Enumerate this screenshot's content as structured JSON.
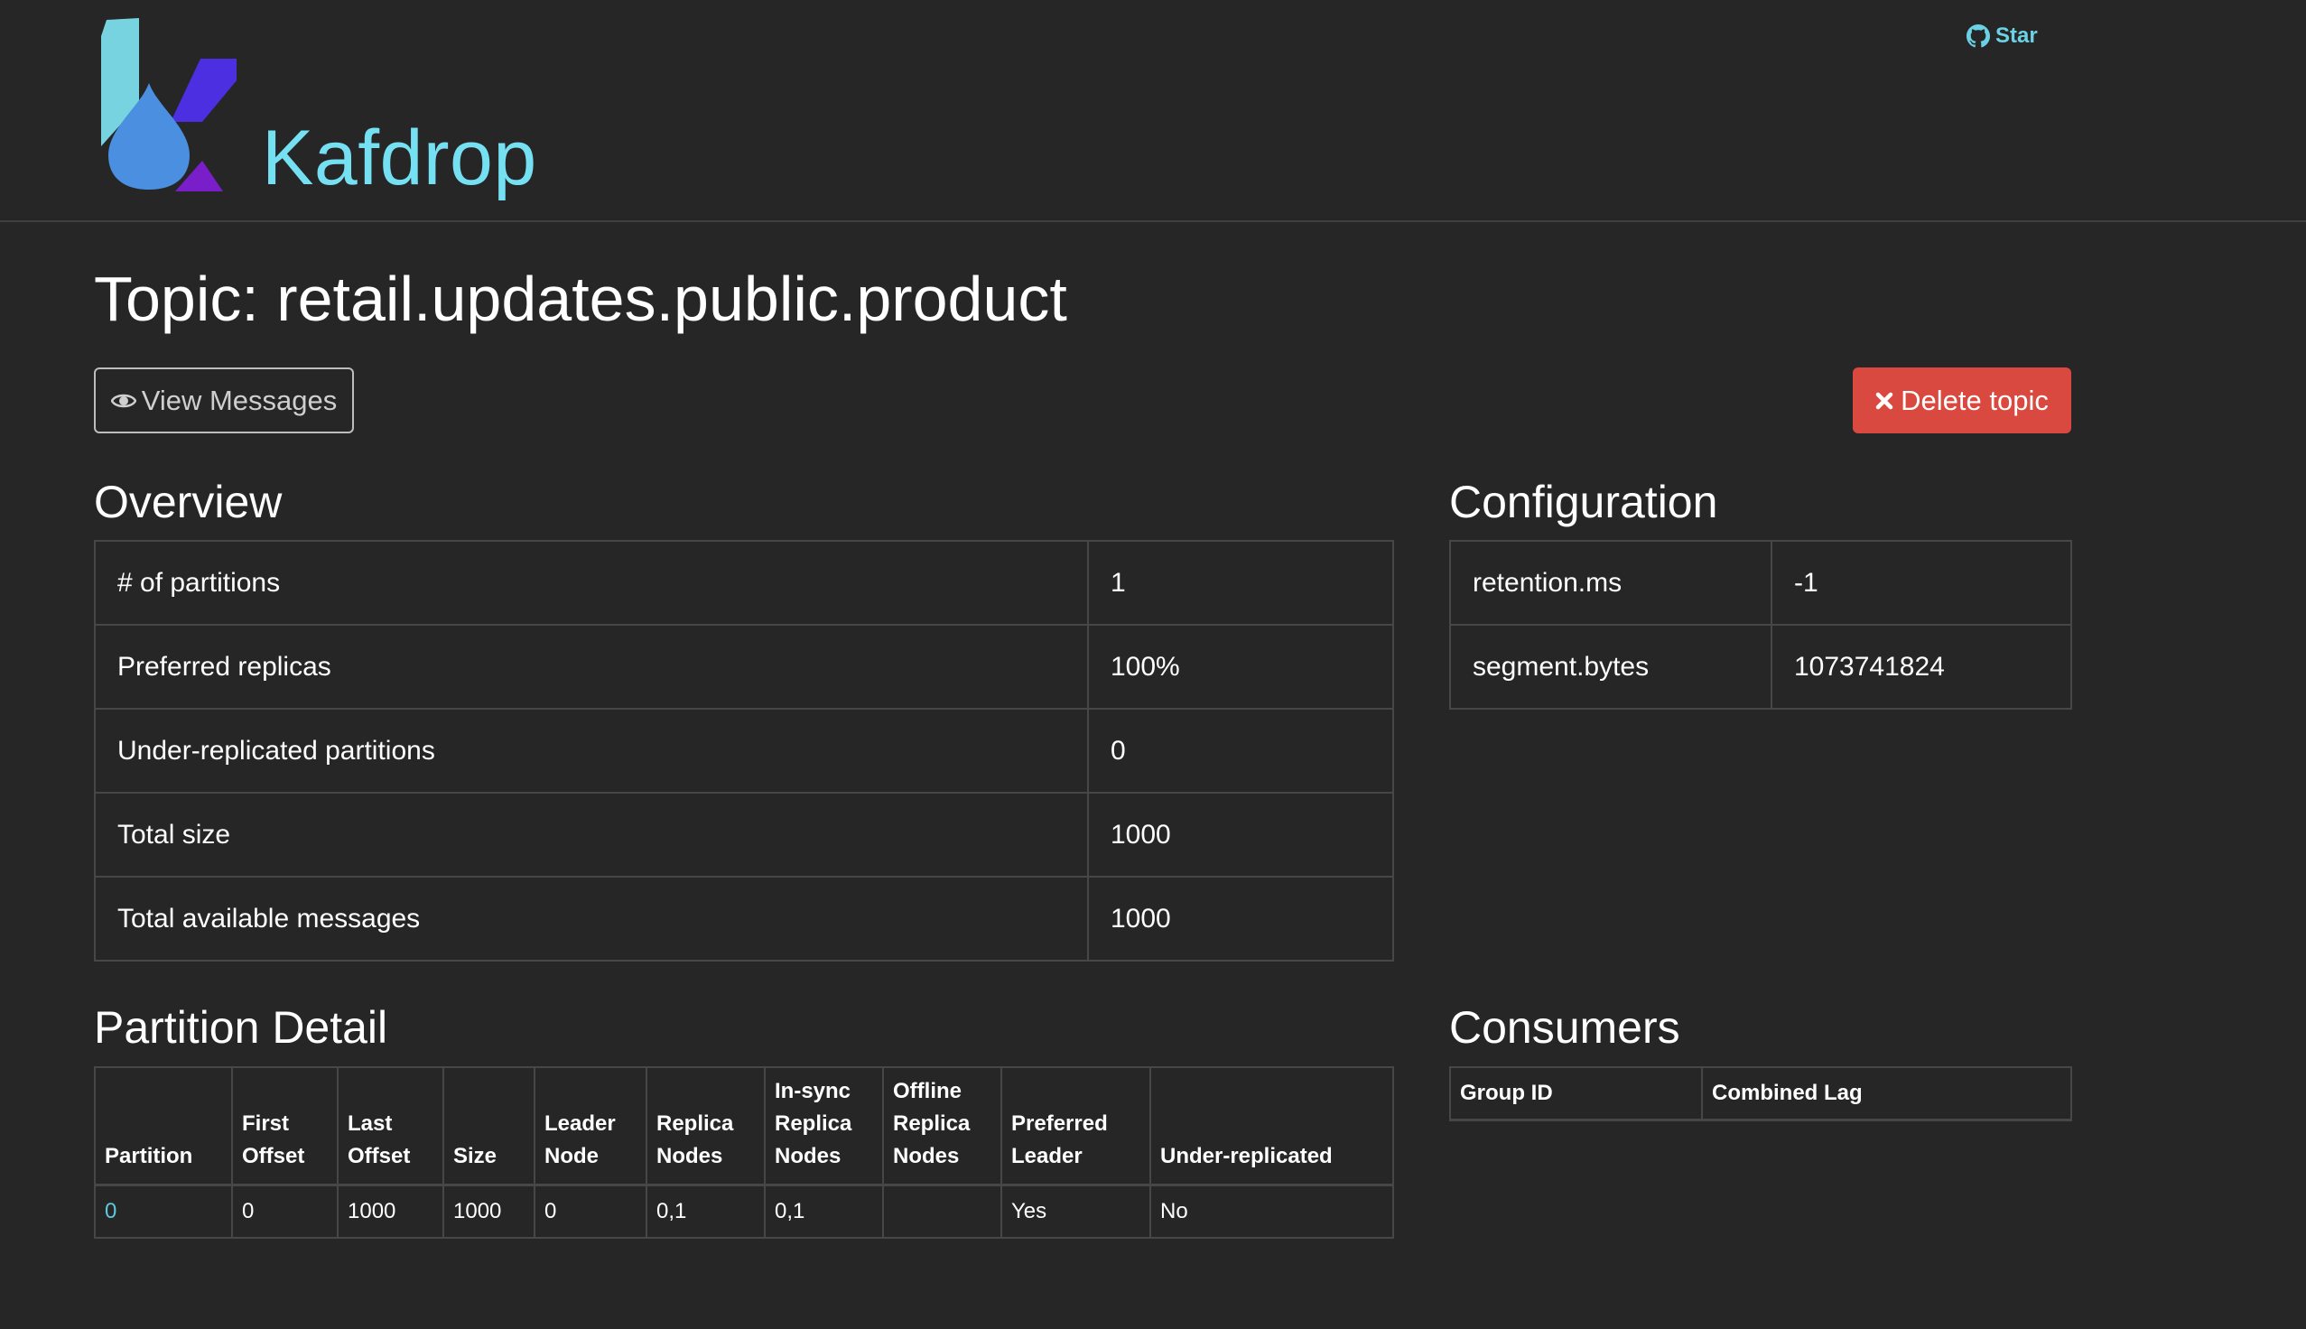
{
  "app": {
    "brand": "Kafdrop",
    "star_label": "Star"
  },
  "page": {
    "title": "Topic: retail.updates.public.product"
  },
  "actions": {
    "view_messages": "View Messages",
    "delete_topic": "Delete topic"
  },
  "overview": {
    "title": "Overview",
    "rows": [
      {
        "label": "# of partitions",
        "value": "1"
      },
      {
        "label": "Preferred replicas",
        "value": "100%"
      },
      {
        "label": "Under-replicated partitions",
        "value": "0"
      },
      {
        "label": "Total size",
        "value": "1000"
      },
      {
        "label": "Total available messages",
        "value": "1000"
      }
    ]
  },
  "configuration": {
    "title": "Configuration",
    "rows": [
      {
        "key": "retention.ms",
        "value": "-1"
      },
      {
        "key": "segment.bytes",
        "value": "1073741824"
      }
    ]
  },
  "partition_detail": {
    "title": "Partition Detail",
    "columns": [
      "Partition",
      "First Offset",
      "Last Offset",
      "Size",
      "Leader Node",
      "Replica Nodes",
      "In-sync Replica Nodes",
      "Offline Replica Nodes",
      "Preferred Leader",
      "Under-replicated"
    ],
    "rows": [
      {
        "partition": "0",
        "first_offset": "0",
        "last_offset": "1000",
        "size": "1000",
        "leader_node": "0",
        "replica_nodes": "0,1",
        "in_sync_replica_nodes": "0,1",
        "offline_replica_nodes": "",
        "preferred_leader": "Yes",
        "under_replicated": "No"
      }
    ]
  },
  "consumers": {
    "title": "Consumers",
    "columns": [
      "Group ID",
      "Combined Lag"
    ]
  },
  "icons": {
    "github": "github-icon",
    "view": "eye-icon",
    "delete": "close-icon"
  },
  "colors": {
    "background": "#262626",
    "brand": "#76e0f3",
    "delete": "#d9493f",
    "link": "#5ec8e0"
  }
}
